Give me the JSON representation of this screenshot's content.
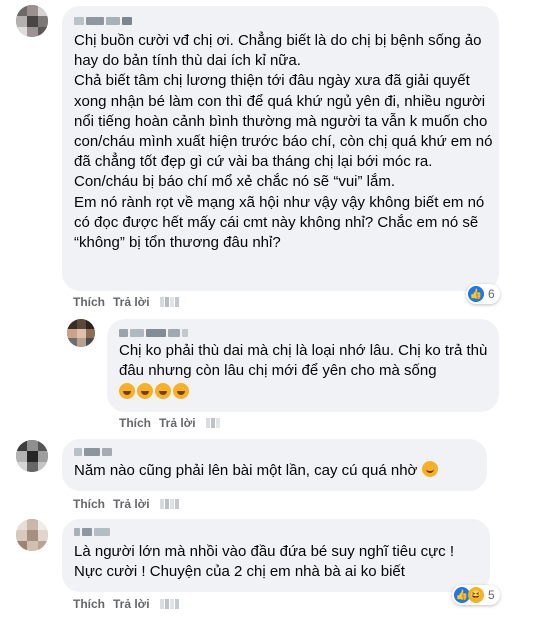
{
  "comments": [
    {
      "paragraphs": [
        "Chị buồn cười vđ chị ơi. Chẳng biết là do chị bị bệnh sống ảo hay do bản tính thù dai ích kỉ nữa.",
        "Chả biết tâm chị lương thiện tới đâu ngày xưa đã giải quyết xong nhận bé làm con thì để quá khứ ngủ yên đi, nhiều người nổi tiếng hoàn cảnh bình thường mà người ta vẫn k muốn cho con/cháu mình xuất hiện trước báo chí, còn chị quá khứ em nó đã chẳng tốt đẹp gì cứ vài ba tháng chị lại bới móc ra. Con/cháu bị báo chí mổ xẻ chắc nó sẽ “vui” lắm.",
        "Em nó rành rọt về mạng xã hội như vậy vậy không biết em nó có đọc được hết mấy cái cmt này không nhỉ? Chắc em nó sẽ “không” bị tổn thương đâu nhỉ?"
      ],
      "like_label": "Thích",
      "reply_label": "Trả lời",
      "reaction_count": "6",
      "reaction_icons": [
        "like-icon"
      ]
    },
    {
      "paragraphs": [
        "Chị ko phải thù dai mà chị là loại nhớ lâu. Chị ko trả thù đâu nhưng còn lâu chị mới để yên cho mà sống"
      ],
      "emoji_row": [
        "rofl-emoji",
        "rofl-emoji",
        "rofl-emoji",
        "rofl-emoji"
      ],
      "like_label": "Thích",
      "reply_label": "Trả lời"
    },
    {
      "paragraphs": [
        "Năm nào cũng phải lên bài một lần, cay cú quá nhờ"
      ],
      "trailing_emoji": "smiling-face-emoji",
      "like_label": "Thích",
      "reply_label": "Trả lời"
    },
    {
      "paragraphs": [
        "Là người lớn mà nhồi vào đầu đứa bé suy nghĩ tiêu cực !",
        "Nực cười ! Chuyện của 2 chị em nhà bà ai ko biết"
      ],
      "like_label": "Thích",
      "reply_label": "Trả lời",
      "reaction_count": "5",
      "reaction_icons": [
        "like-icon",
        "haha-icon"
      ]
    }
  ],
  "colors": {
    "bubble": "#f0f2f5",
    "text": "#050505",
    "meta": "#65676b",
    "like": "#1877f2",
    "haha": "#f7b125"
  }
}
